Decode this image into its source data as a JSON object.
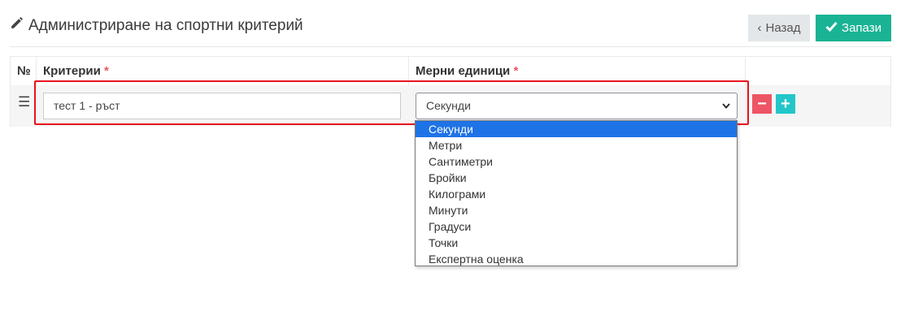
{
  "header": {
    "title": "Администриране на спортни критерий",
    "back_label": "Назад",
    "save_label": "Запази"
  },
  "table": {
    "col_number": "№",
    "col_criteria": "Критерии",
    "col_units": "Мерни единици",
    "required_mark": "*",
    "row": {
      "criteria_value": "тест 1 - ръст",
      "unit_value": "Секунди"
    }
  },
  "dropdown": {
    "selected": "Секунди",
    "options": [
      "Секунди",
      "Метри",
      "Сантиметри",
      "Бройки",
      "Килограми",
      "Минути",
      "Градуси",
      "Точки",
      "Експертна оценка"
    ]
  },
  "colors": {
    "save": "#1ab394",
    "back": "#e4e7ea",
    "remove": "#ed5565",
    "add": "#23c6c8",
    "highlight": "#e8121d",
    "selected_option": "#1e73e6"
  }
}
